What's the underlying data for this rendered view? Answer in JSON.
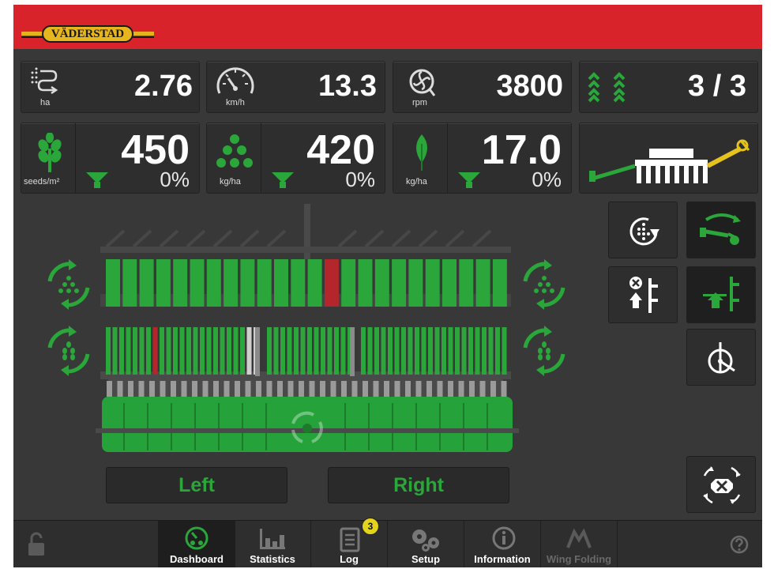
{
  "brand": {
    "name": "VÄDERSTAD"
  },
  "colors": {
    "accent": "#2aa63a",
    "header": "#d8232a",
    "alarm": "#b3272c",
    "badge": "#e4d31d"
  },
  "metrics_row1": [
    {
      "icon": "area-icon",
      "value": "2.76",
      "unit": "ha"
    },
    {
      "icon": "speedometer-icon",
      "value": "13.3",
      "unit": "km/h"
    },
    {
      "icon": "fan-icon",
      "value": "3800",
      "unit": "rpm"
    },
    {
      "icon": "rows-icon",
      "value": "3 / 3"
    }
  ],
  "metrics_row2": [
    {
      "icon": "wheat-icon",
      "value": "450",
      "percent": "0%",
      "unit": "seeds/m²"
    },
    {
      "icon": "fertilizer-icon",
      "value": "420",
      "percent": "0%",
      "unit": "kg/ha"
    },
    {
      "icon": "leaf-icon",
      "value": "17.0",
      "percent": "0%",
      "unit": "kg/ha"
    }
  ],
  "drill_view": {
    "left_label": "Left",
    "right_label": "Right"
  },
  "nav": {
    "items": [
      {
        "label": "Dashboard",
        "icon": "dashboard-icon",
        "active": true
      },
      {
        "label": "Statistics",
        "icon": "statistics-icon"
      },
      {
        "label": "Log",
        "icon": "log-icon",
        "badge": "3"
      },
      {
        "label": "Setup",
        "icon": "setup-icon"
      },
      {
        "label": "Information",
        "icon": "information-icon"
      },
      {
        "label": "Wing Folding",
        "icon": "wing-folding-icon",
        "disabled": true
      }
    ],
    "help_icon": "help-icon",
    "lock_icon": "lock-icon"
  }
}
